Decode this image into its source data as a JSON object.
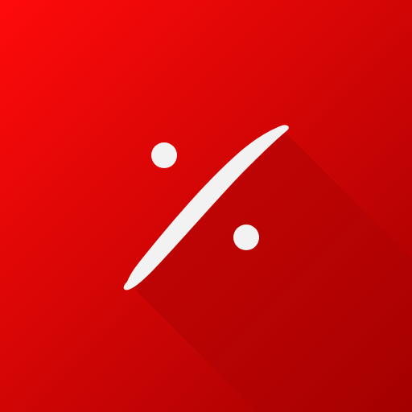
{
  "icon": {
    "name": "percent-icon",
    "colors": {
      "background_top_left": "#ff0a0a",
      "background_bottom_right": "#a40000",
      "long_shadow": "#8a0000",
      "glyph": "#f2f2f2"
    }
  }
}
